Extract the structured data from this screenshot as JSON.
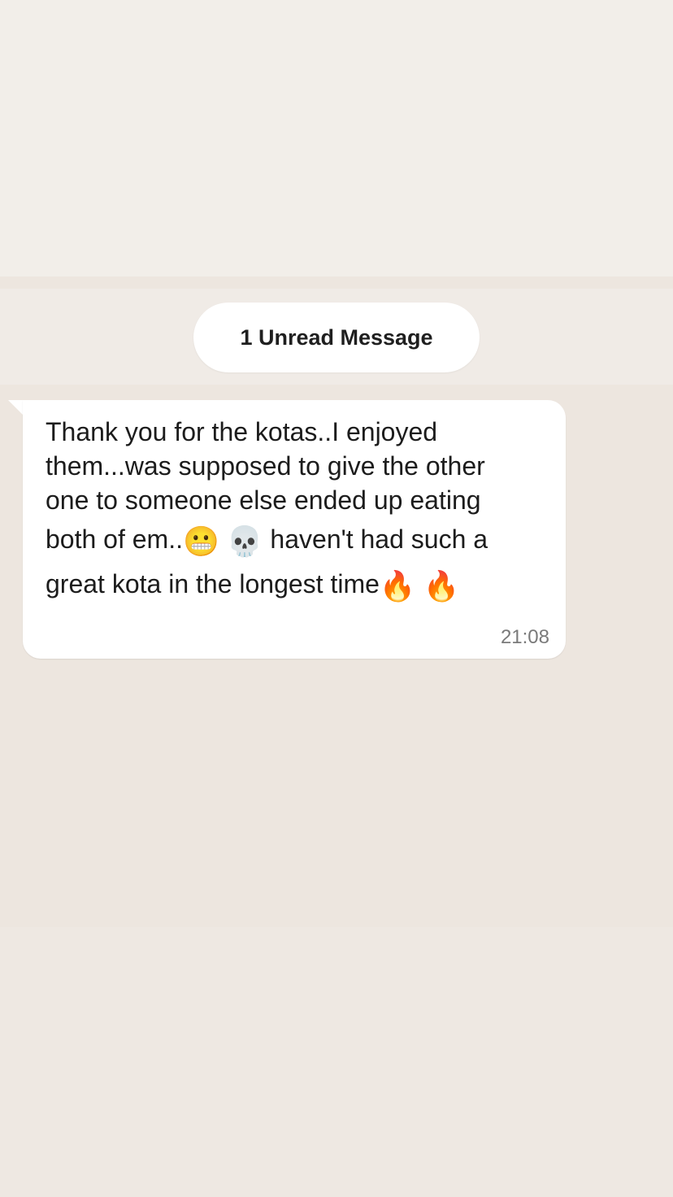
{
  "unread_divider": {
    "label": "1 Unread Message"
  },
  "message": {
    "lines": [
      "Thank you for the  kotas..I enjoyed",
      "them...was supposed to give the other",
      "one to someone else ended up eating"
    ],
    "line4_before": "both of em..",
    "line4_emoji1": "😬",
    "line4_emoji2": "💀",
    "line4_after": " haven't had such a",
    "line5_before": "great kota in the longest time",
    "line5_emoji1": "🔥",
    "line5_emoji2": "🔥",
    "time": "21:08"
  },
  "colors": {
    "background": "#f1ede8",
    "chat_background": "#ede6df",
    "bubble": "#ffffff",
    "text": "#1c1c1c",
    "timestamp": "#7a7a7a"
  }
}
